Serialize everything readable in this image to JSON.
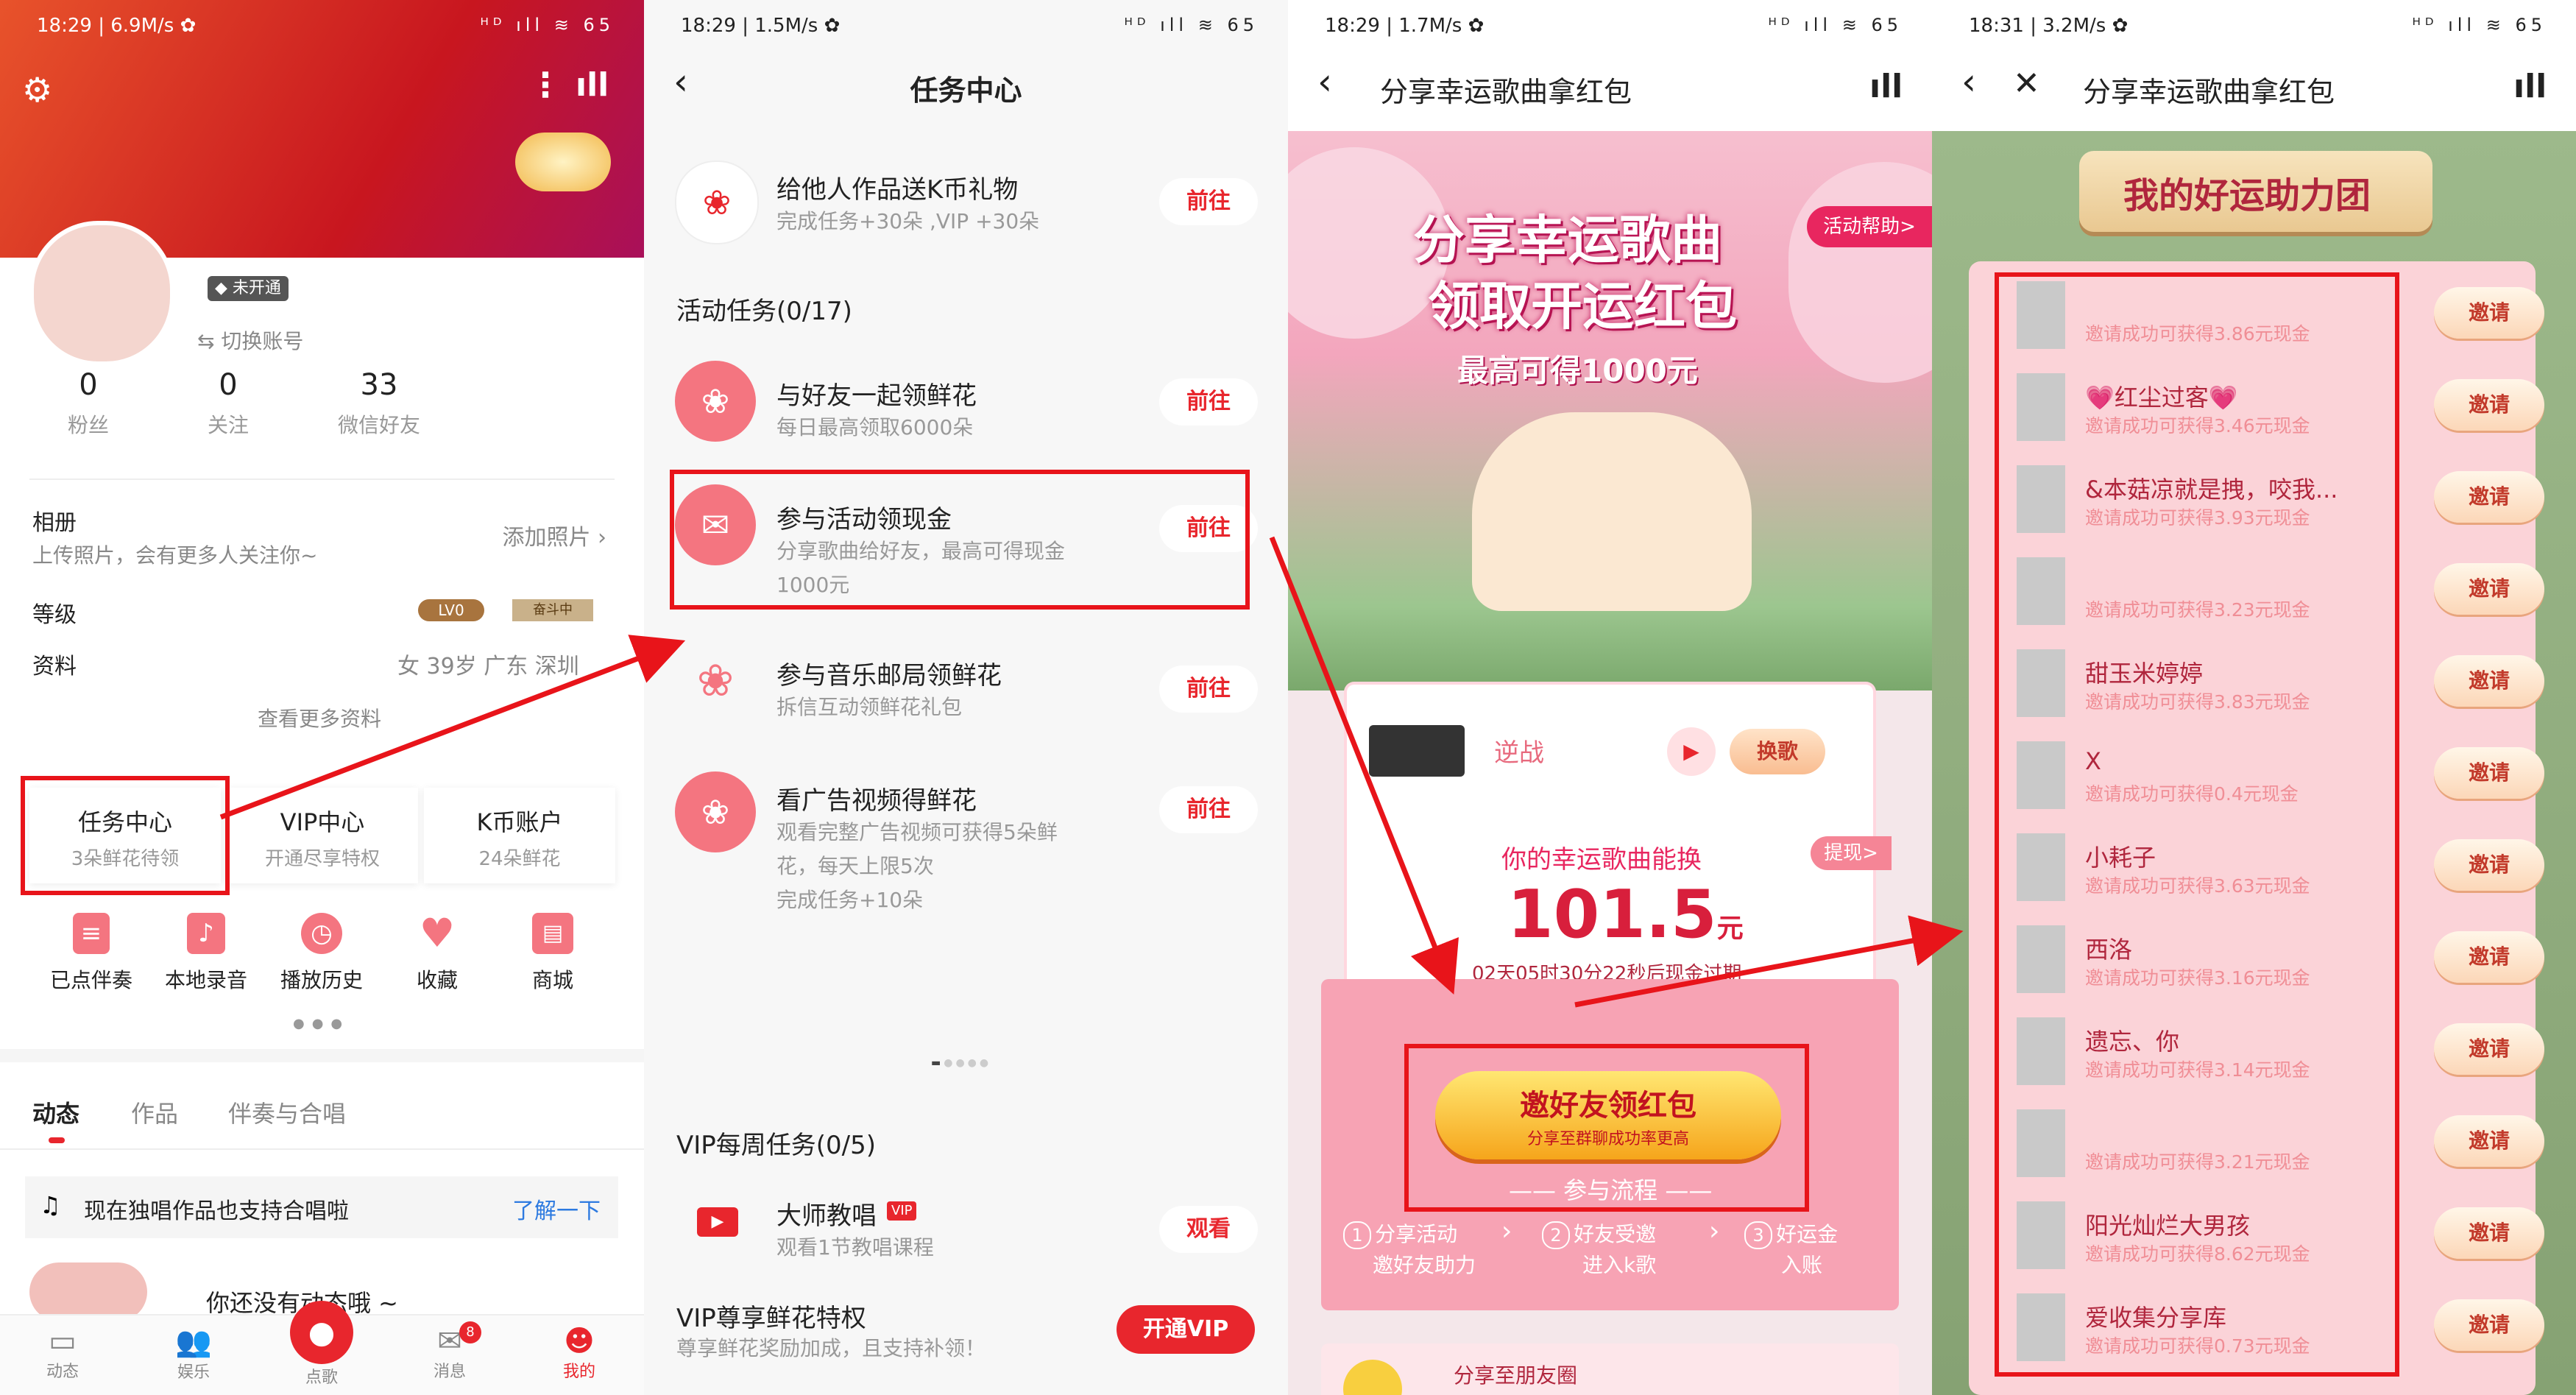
{
  "p1": {
    "status_time": "18:29 | 6.9M/s ✿",
    "status_icons": "ᴴᴰ ıll ≋ 65",
    "vip_badge": "未开通",
    "switch_account": "⇆ 切换账号",
    "stats": [
      {
        "num": "0",
        "label": "粉丝"
      },
      {
        "num": "0",
        "label": "关注"
      },
      {
        "num": "33",
        "label": "微信好友"
      }
    ],
    "album_title": "相册",
    "album_desc": "上传照片，会有更多人关注你~",
    "album_add": "添加照片",
    "level_label": "等级",
    "level_badge1": "LV0",
    "level_badge2": "奋斗中",
    "info_label": "资料",
    "info_value": "女  39岁  广东 深圳",
    "more_info": "查看更多资料",
    "cards": [
      {
        "title": "任务中心",
        "sub": "3朵鲜花待领"
      },
      {
        "title": "VIP中心",
        "sub": "开通尽享特权"
      },
      {
        "title": "K币账户",
        "sub": "24朵鲜花"
      }
    ],
    "quick": [
      {
        "label": "已点伴奏",
        "icon": "list-icon"
      },
      {
        "label": "本地录音",
        "icon": "music-note-icon"
      },
      {
        "label": "播放历史",
        "icon": "clock-icon"
      },
      {
        "label": "收藏",
        "icon": "heart-icon"
      },
      {
        "label": "商城",
        "icon": "shop-icon"
      }
    ],
    "tabs": [
      "动态",
      "作品",
      "伴奏与合唱"
    ],
    "notice": "现在独唱作品也支持合唱啦",
    "notice_link": "了解一下",
    "empty_text": "你还没有动态哦 ~",
    "bottom_nav": [
      "动态",
      "娱乐",
      "点歌",
      "消息",
      "我的"
    ],
    "msg_badge": "8"
  },
  "p2": {
    "status_time": "18:29 | 1.5M/s ✿",
    "status_icons": "ᴴᴰ ıll ≋ 65",
    "title": "任务中心",
    "top_task": {
      "title": "给他人作品送K币礼物",
      "desc": "完成任务+30朵 ,VIP +30朵",
      "btn": "前往"
    },
    "activity_header": "活动任务(0/17)",
    "tasks": [
      {
        "title": "与好友一起领鲜花",
        "desc": "每日最高领取6000朵",
        "btn": "前往"
      },
      {
        "title": "参与活动领现金",
        "desc": "分享歌曲给好友，最高可得现金",
        "desc2": "1000元",
        "btn": "前往"
      },
      {
        "title": "参与音乐邮局领鲜花",
        "desc": "拆信互动领鲜花礼包",
        "btn": "前往"
      },
      {
        "title": "看广告视频得鲜花",
        "desc": "观看完整广告视频可获得5朵鲜",
        "desc2": "花，每天上限5次",
        "desc3": "完成任务+10朵",
        "btn": "前往"
      }
    ],
    "vip_header": "VIP每周任务(0/5)",
    "vip_task": {
      "title": "大师教唱",
      "badge": "VIP",
      "desc": "观看1节教唱课程",
      "btn": "观看"
    },
    "vip_priv": {
      "title": "VIP尊享鲜花特权",
      "desc": "尊享鲜花奖励加成，且支持补领！",
      "btn": "开通VIP"
    }
  },
  "p3": {
    "status_time": "18:29 | 1.7M/s ✿",
    "status_icons": "ᴴᴰ ıll ≋ 65",
    "title": "分享幸运歌曲拿红包",
    "banner_line1": "分享幸运歌曲",
    "banner_line2": "领取开运红包",
    "banner_line3": "最高可得1000元",
    "help": "活动帮助>",
    "song_name": "逆战",
    "change_song": "换歌",
    "lucky_label": "你的幸运歌曲能换",
    "withdraw": "提现>",
    "amount": "101.5",
    "unit": "元",
    "expire": "02天05时30分22秒后现金过期",
    "invite_btn": "邀好友领红包",
    "invite_sub": "分享至群聊成功率更高",
    "process_title": "参与流程",
    "steps": [
      {
        "n": "1",
        "a": "分享活动",
        "b": "邀好友助力"
      },
      {
        "n": "2",
        "a": "好友受邀",
        "b": "进入k歌"
      },
      {
        "n": "3",
        "a": "好运金",
        "b": "入账"
      }
    ],
    "share_moments": "分享至朋友圈"
  },
  "p4": {
    "status_time": "18:31 | 3.2M/s ✿",
    "status_icons": "ᴴᴰ ıll ≋ 65",
    "title": "分享幸运歌曲拿红包",
    "board_title": "我的好运助力团",
    "invite_label": "邀请",
    "rows": [
      {
        "name": "",
        "sub": "邀请成功可获得3.86元现金"
      },
      {
        "name": "💗红尘过客💗",
        "sub": "邀请成功可获得3.46元现金"
      },
      {
        "name": "&本菇凉就是拽，咬我...",
        "sub": "邀请成功可获得3.93元现金"
      },
      {
        "name": "",
        "sub": "邀请成功可获得3.23元现金"
      },
      {
        "name": "甜玉米婷婷",
        "sub": "邀请成功可获得3.83元现金"
      },
      {
        "name": "X",
        "sub": "邀请成功可获得0.4元现金"
      },
      {
        "name": "小耗子",
        "sub": "邀请成功可获得3.63元现金"
      },
      {
        "name": "西洛",
        "sub": "邀请成功可获得3.16元现金"
      },
      {
        "name": "遗忘、你",
        "sub": "邀请成功可获得3.14元现金"
      },
      {
        "name": "",
        "sub": "邀请成功可获得3.21元现金"
      },
      {
        "name": "阳光灿烂大男孩",
        "sub": "邀请成功可获得8.62元现金"
      },
      {
        "name": "爱收集分享库",
        "sub": "邀请成功可获得0.73元现金"
      }
    ]
  },
  "colors": {
    "accent": "#e8262d",
    "highlight": "#e8141a",
    "pink": "#f47580"
  }
}
